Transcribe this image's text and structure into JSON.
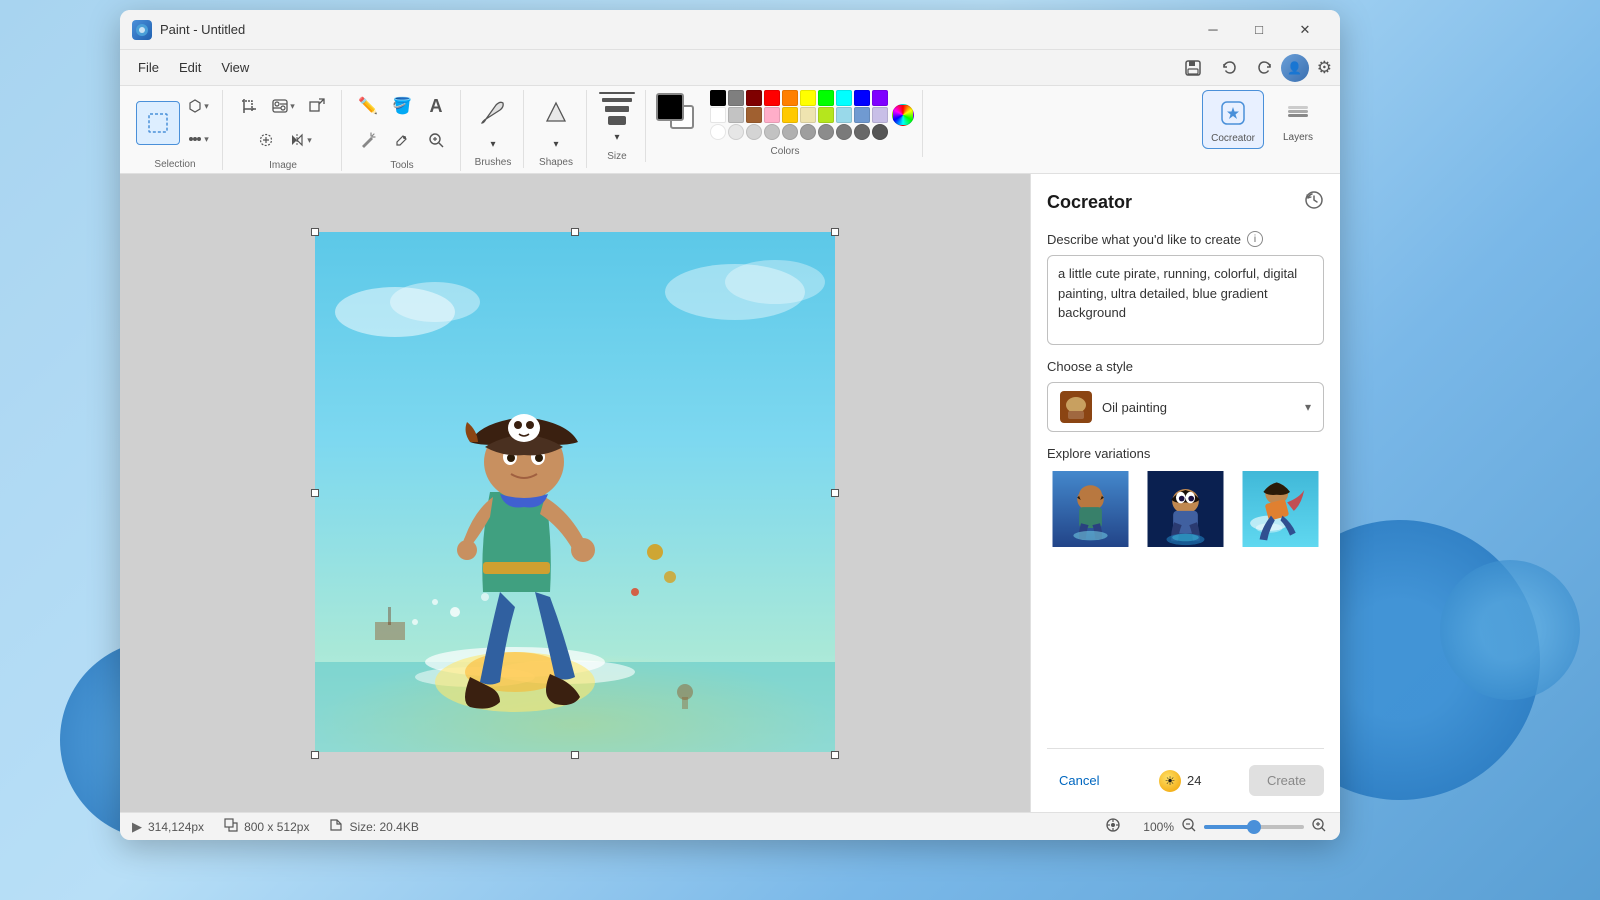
{
  "window": {
    "title": "Paint - Untitled",
    "app_icon": "🎨"
  },
  "titlebar": {
    "minimize": "─",
    "maximize": "□",
    "close": "✕"
  },
  "menu": {
    "items": [
      "File",
      "Edit",
      "View"
    ],
    "save_tooltip": "Save",
    "undo_tooltip": "Undo",
    "redo_tooltip": "Redo"
  },
  "ribbon": {
    "groups": {
      "selection": {
        "label": "Selection"
      },
      "image": {
        "label": "Image"
      },
      "tools": {
        "label": "Tools"
      },
      "brushes": {
        "label": "Brushes"
      },
      "shapes": {
        "label": "Shapes"
      },
      "size": {
        "label": "Size"
      },
      "colors": {
        "label": "Colors"
      }
    },
    "cocreator_label": "Cocreator",
    "layers_label": "Layers"
  },
  "colors": {
    "row1": [
      "#000000",
      "#7f7f7f",
      "#7f0000",
      "#ff0000",
      "#ff7f00",
      "#ffff00",
      "#00ff00",
      "#00ffff",
      "#0000ff",
      "#7f00ff"
    ],
    "row2": [
      "#ffffff",
      "#c3c3c3",
      "#a06030",
      "#ffaec9",
      "#ffc900",
      "#efe4b0",
      "#b5e61d",
      "#99d9ea",
      "#709ad1",
      "#c8bfe7"
    ],
    "row3": [
      "#ffffff",
      "#e6e6e6",
      "#d4d4d4",
      "#c2c2c2",
      "#b0b0b0",
      "#9e9e9e",
      "#8c8c8c",
      "#7a7a7a",
      "#686868",
      "#565656"
    ]
  },
  "cocreator": {
    "panel_title": "Cocreator",
    "prompt_label": "Describe what you'd like to create",
    "prompt_value": "a little cute pirate, running, colorful, digital painting, ultra detailed, blue gradient background",
    "style_label": "Choose a style",
    "style_name": "Oil painting",
    "variations_label": "Explore variations",
    "cancel_label": "Cancel",
    "credits_count": "24",
    "create_label": "Create"
  },
  "statusbar": {
    "position": "314,124px",
    "dimensions": "800 x 512px",
    "size": "Size: 20.4KB",
    "zoom": "100%"
  }
}
